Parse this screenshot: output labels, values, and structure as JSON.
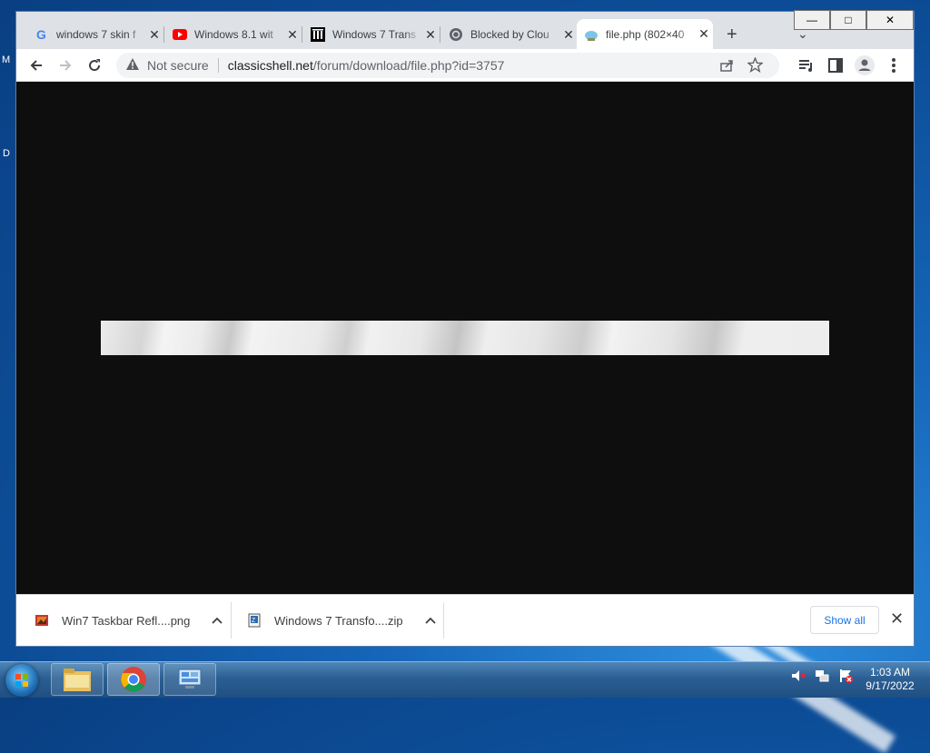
{
  "desktop": {
    "letters": [
      "M",
      "D"
    ]
  },
  "window": {
    "minimize": "—",
    "maximize": "□",
    "close": "✕"
  },
  "tabs": [
    {
      "title": "windows 7 skin f",
      "icon": "google-icon",
      "close": "✕"
    },
    {
      "title": "Windows 8.1 wit",
      "icon": "youtube-icon",
      "close": "✕"
    },
    {
      "title": "Windows 7 Trans",
      "icon": "museum-icon",
      "close": "✕"
    },
    {
      "title": "Blocked by Clou",
      "icon": "globe-icon",
      "close": "✕"
    },
    {
      "title": "file.php (802×40",
      "icon": "image-icon",
      "close": "✕",
      "active": true
    }
  ],
  "newtab_label": "+",
  "tab_menu_label": "⌄",
  "toolbar": {
    "security_label": "Not secure",
    "url_domain": "classicshell.net",
    "url_path": "/forum/download/file.php?id=3757"
  },
  "downloads": {
    "items": [
      {
        "name": "Win7 Taskbar Refl....png",
        "icon": "png-file-icon"
      },
      {
        "name": "Windows 7 Transfo....zip",
        "icon": "zip-file-icon"
      }
    ],
    "show_all": "Show all",
    "close": "✕"
  },
  "taskbar": {
    "apps": [
      "file-explorer",
      "chrome",
      "control-panel"
    ],
    "clock_time": "1:03 AM",
    "clock_date": "9/17/2022"
  },
  "colors": {
    "accent": "#1a73e8",
    "content_bg": "#0e0e0e",
    "taskbar": "#2b5f93"
  }
}
